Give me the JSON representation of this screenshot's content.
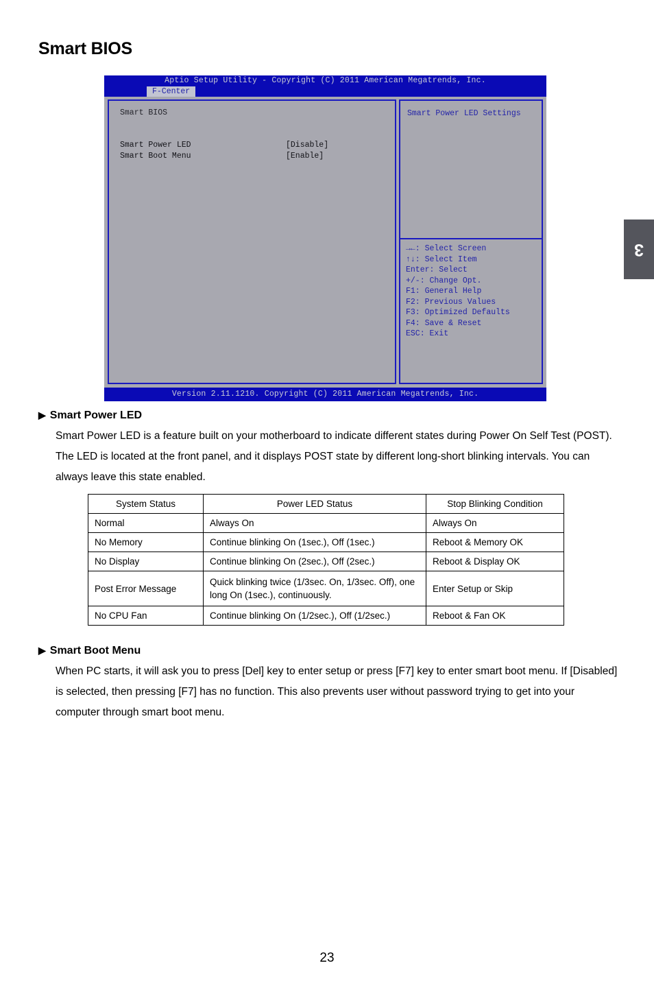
{
  "page": {
    "title": "Smart BIOS",
    "number": "23",
    "chapter_tab": "3"
  },
  "bios": {
    "titlebar": "Aptio Setup Utility - Copyright (C) 2011 American Megatrends, Inc.",
    "tab": "F-Center",
    "section_heading": "Smart BIOS",
    "settings": [
      {
        "label": "Smart Power LED",
        "value": "[Disable]"
      },
      {
        "label": "Smart Boot Menu",
        "value": "[Enable]"
      }
    ],
    "help_title": "Smart Power LED Settings",
    "keys": [
      "→←: Select Screen",
      "↑↓: Select Item",
      "Enter: Select",
      "+/-: Change Opt.",
      "F1: General Help",
      "F2: Previous Values",
      "F3: Optimized Defaults",
      "F4: Save & Reset",
      "ESC: Exit"
    ],
    "footer": "Version 2.11.1210. Copyright (C) 2011 American Megatrends, Inc.",
    "colors": {
      "screen_blue": "#0a0ab5",
      "panel_gray": "#a8a8b0",
      "border_blue": "#1a1ac0",
      "tab_highlight": "#c2c4d2",
      "help_text_blue": "#2323a8"
    }
  },
  "sections": [
    {
      "bullet": "▶",
      "heading": "Smart Power LED",
      "body": "Smart Power LED is a feature built on your motherboard to indicate different states during Power On Self Test (POST). The LED is located at the front panel, and it displays POST state by different long-short blinking intervals. You can always leave this state enabled."
    },
    {
      "bullet": "▶",
      "heading": "Smart Boot Menu",
      "body": "When PC starts, it will ask you to press [Del] key to enter setup or press [F7] key to enter smart boot menu. If [Disabled] is selected, then pressing [F7] has no function. This also prevents user without password trying to get into your computer through smart boot menu."
    }
  ],
  "led_table": {
    "headers": [
      "System Status",
      "Power LED Status",
      "Stop Blinking Condition"
    ],
    "rows": [
      {
        "status": "Normal",
        "led": "Always On",
        "stop": "Always On"
      },
      {
        "status": "No Memory",
        "led": "Continue blinking On (1sec.), Off (1sec.)",
        "stop": "Reboot & Memory OK"
      },
      {
        "status": "No Display",
        "led": "Continue blinking On (2sec.), Off (2sec.)",
        "stop": "Reboot & Display OK"
      },
      {
        "status": "Post Error Message",
        "led": "Quick blinking twice (1/3sec. On, 1/3sec. Off), one long On (1sec.), continuously.",
        "stop": "Enter Setup or Skip"
      },
      {
        "status": "No CPU Fan",
        "led": "Continue blinking On (1/2sec.), Off (1/2sec.)",
        "stop": "Reboot & Fan OK"
      }
    ]
  }
}
